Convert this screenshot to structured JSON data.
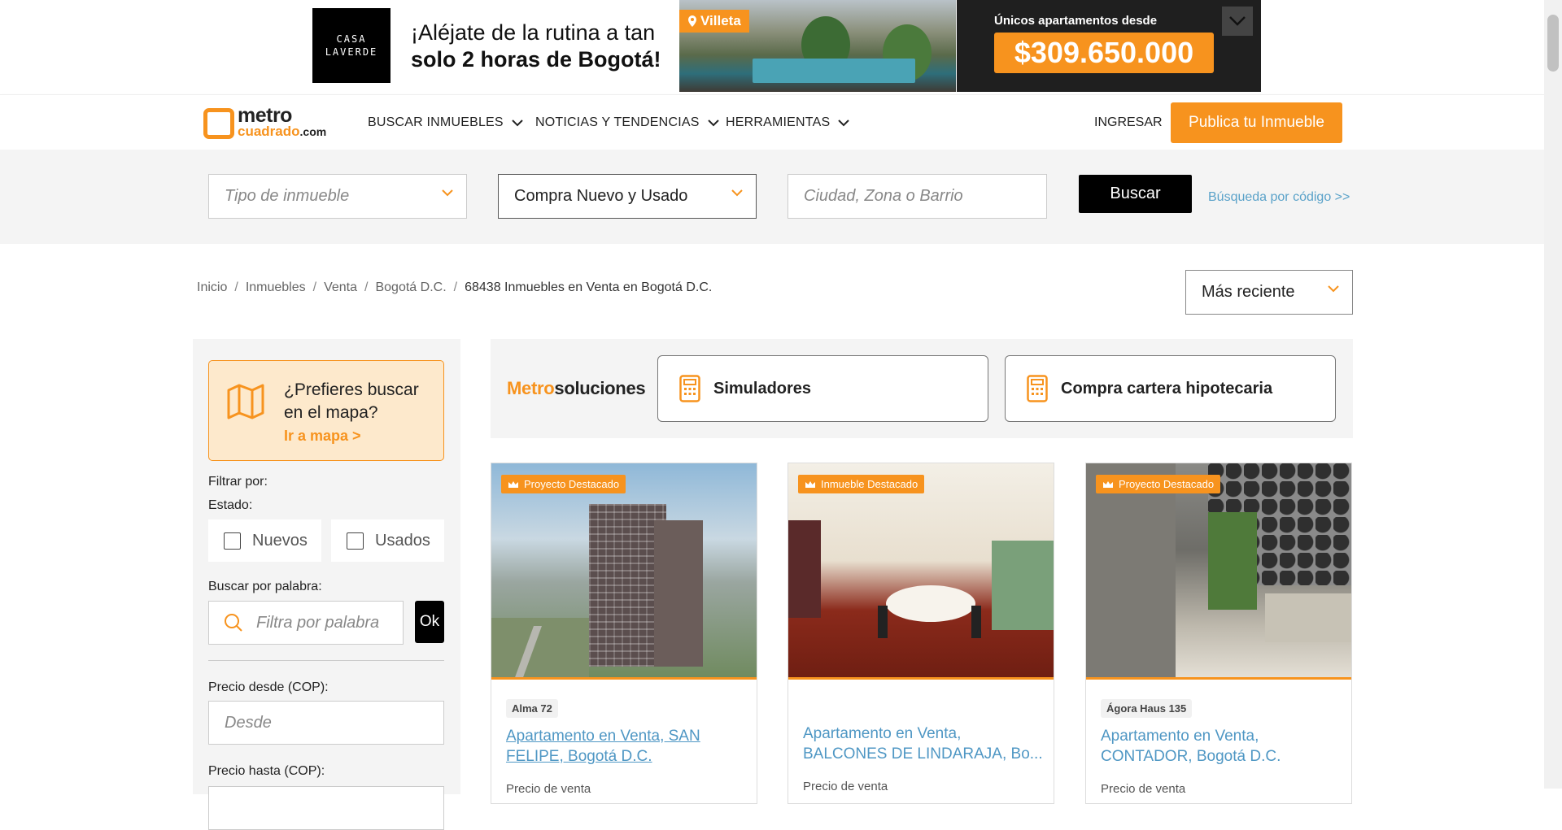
{
  "ad": {
    "logo_text": "CASA\nLAVERDE",
    "headline_1": "¡Aléjate de la rutina a tan",
    "headline_2": "solo 2 horas de Bogotá!",
    "location_tag": "Villeta",
    "caption": "Únicos apartamentos desde",
    "price": "$309.650.000"
  },
  "header": {
    "logo_top": "metro",
    "logo_bottom": "cuadrado",
    "logo_suffix": ".com",
    "nav": [
      {
        "label": "BUSCAR INMUEBLES"
      },
      {
        "label": "NOTICIAS Y TENDENCIAS"
      },
      {
        "label": "HERRAMIENTAS"
      }
    ],
    "login": "INGRESAR",
    "publish": "Publica tu Inmueble"
  },
  "search": {
    "type_placeholder": "Tipo de inmueble",
    "operation_value": "Compra Nuevo y Usado",
    "location_placeholder": "Ciudad, Zona o Barrio",
    "button": "Buscar",
    "code_link": "Búsqueda por código >>"
  },
  "breadcrumb": {
    "items": [
      "Inicio",
      "Inmuebles",
      "Venta",
      "Bogotá D.C."
    ],
    "current": "68438 Inmuebles en Venta en Bogotá D.C."
  },
  "sort": {
    "value": "Más reciente"
  },
  "sidebar": {
    "map_question": "¿Prefieres buscar en el mapa?",
    "map_link": "Ir a mapa >",
    "filter_by": "Filtrar por:",
    "state_label": "Estado:",
    "state_options": [
      "Nuevos",
      "Usados"
    ],
    "keyword_label": "Buscar por palabra:",
    "keyword_placeholder": "Filtra por palabra",
    "keyword_button": "Ok",
    "price_from_label": "Precio desde (COP):",
    "price_from_placeholder": "Desde",
    "price_to_label": "Precio hasta (COP):"
  },
  "metrosoluciones": {
    "brand_orange": "Metro",
    "brand_dark": "soluciones",
    "buttons": [
      "Simuladores",
      "Compra cartera hipotecaria"
    ]
  },
  "listings": [
    {
      "badge": "Proyecto Destacado",
      "project": "Alma 72",
      "title": "Apartamento en Venta, SAN FELIPE, Bogotá D.C.",
      "price_label": "Precio de venta"
    },
    {
      "badge": "Inmueble Destacado",
      "project": "",
      "title": "Apartamento en Venta, BALCONES DE LINDARAJA, Bo...",
      "price_label": "Precio de venta"
    },
    {
      "badge": "Proyecto Destacado",
      "project": "Ágora Haus 135",
      "title": "Apartamento en Venta, CONTADOR, Bogotá D.C.",
      "price_label": "Precio de venta"
    }
  ],
  "colors": {
    "accent": "#f7931e",
    "link": "#4f97c4",
    "dark": "#000000"
  }
}
